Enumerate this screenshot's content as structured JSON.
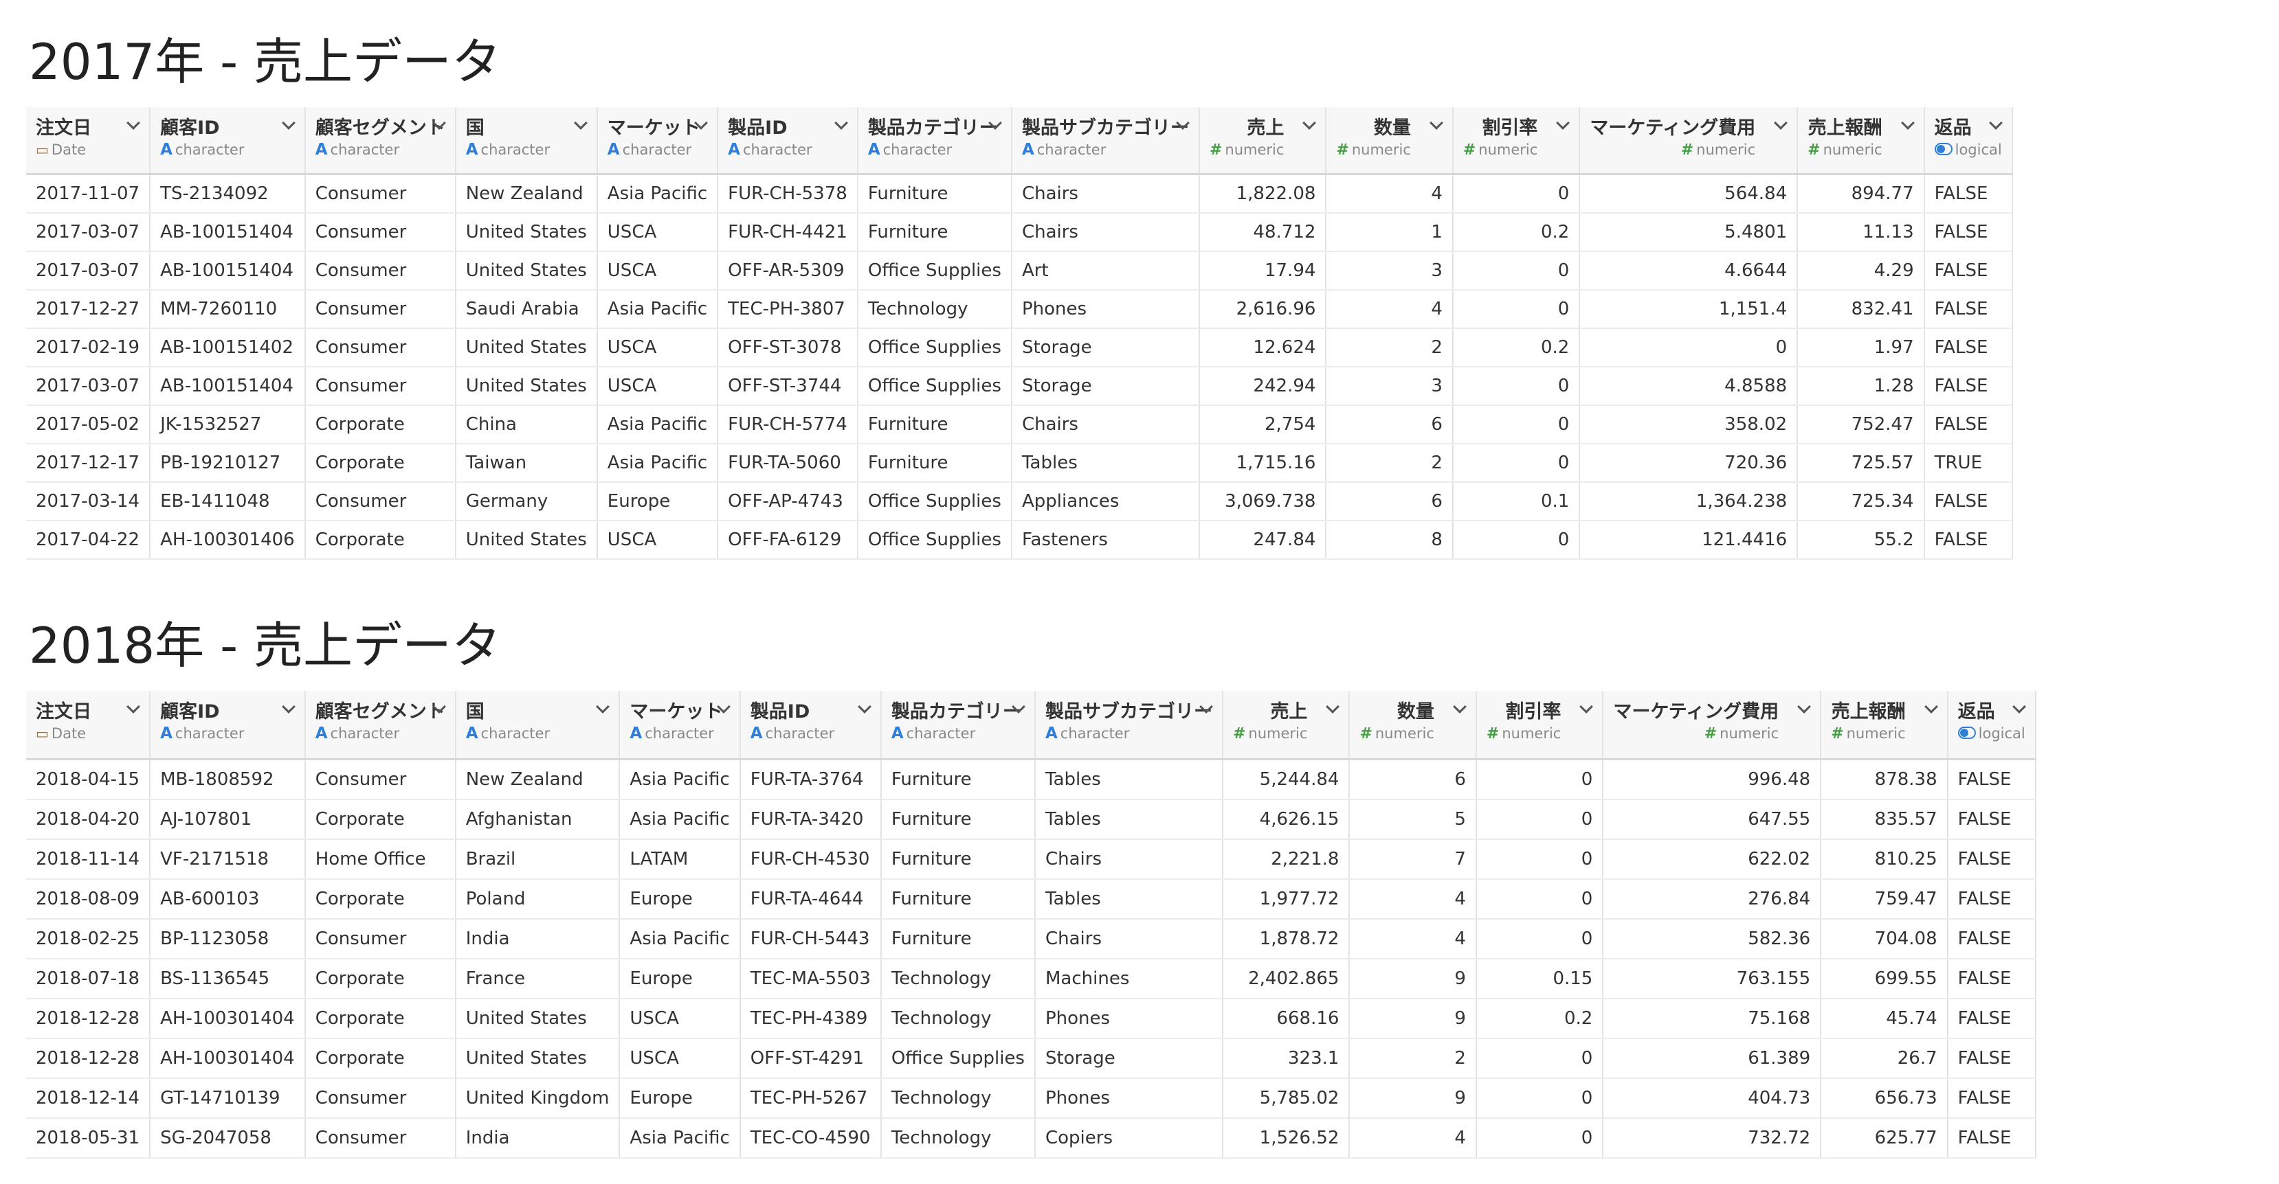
{
  "tables": [
    {
      "title": "2017年 - 売上データ",
      "columns": [
        {
          "name": "注文日",
          "type": "Date",
          "icon": "calendar-icon",
          "align": "left"
        },
        {
          "name": "顧客ID",
          "type": "character",
          "icon": "text-type-icon",
          "align": "left"
        },
        {
          "name": "顧客セグメント",
          "type": "character",
          "icon": "text-type-icon",
          "align": "left"
        },
        {
          "name": "国",
          "type": "character",
          "icon": "text-type-icon",
          "align": "left"
        },
        {
          "name": "マーケット",
          "type": "character",
          "icon": "text-type-icon",
          "align": "left"
        },
        {
          "name": "製品ID",
          "type": "character",
          "icon": "text-type-icon",
          "align": "left"
        },
        {
          "name": "製品カテゴリー",
          "type": "character",
          "icon": "text-type-icon",
          "align": "left"
        },
        {
          "name": "製品サブカテゴリー",
          "type": "character",
          "icon": "text-type-icon",
          "align": "left"
        },
        {
          "name": "売上",
          "type": "numeric",
          "icon": "hash-icon",
          "align": "right"
        },
        {
          "name": "数量",
          "type": "numeric",
          "icon": "hash-icon",
          "align": "right"
        },
        {
          "name": "割引率",
          "type": "numeric",
          "icon": "hash-icon",
          "align": "right"
        },
        {
          "name": "マーケティング費用",
          "type": "numeric",
          "icon": "hash-icon",
          "align": "right"
        },
        {
          "name": "売上報酬",
          "type": "numeric",
          "icon": "hash-icon",
          "align": "right"
        },
        {
          "name": "返品",
          "type": "logical",
          "icon": "toggle-icon",
          "align": "left"
        }
      ],
      "rows": [
        [
          "2017-11-07",
          "TS-2134092",
          "Consumer",
          "New Zealand",
          "Asia Pacific",
          "FUR-CH-5378",
          "Furniture",
          "Chairs",
          "1,822.08",
          "4",
          "0",
          "564.84",
          "894.77",
          "FALSE"
        ],
        [
          "2017-03-07",
          "AB-100151404",
          "Consumer",
          "United States",
          "USCA",
          "FUR-CH-4421",
          "Furniture",
          "Chairs",
          "48.712",
          "1",
          "0.2",
          "5.4801",
          "11.13",
          "FALSE"
        ],
        [
          "2017-03-07",
          "AB-100151404",
          "Consumer",
          "United States",
          "USCA",
          "OFF-AR-5309",
          "Office Supplies",
          "Art",
          "17.94",
          "3",
          "0",
          "4.6644",
          "4.29",
          "FALSE"
        ],
        [
          "2017-12-27",
          "MM-7260110",
          "Consumer",
          "Saudi Arabia",
          "Asia Pacific",
          "TEC-PH-3807",
          "Technology",
          "Phones",
          "2,616.96",
          "4",
          "0",
          "1,151.4",
          "832.41",
          "FALSE"
        ],
        [
          "2017-02-19",
          "AB-100151402",
          "Consumer",
          "United States",
          "USCA",
          "OFF-ST-3078",
          "Office Supplies",
          "Storage",
          "12.624",
          "2",
          "0.2",
          "0",
          "1.97",
          "FALSE"
        ],
        [
          "2017-03-07",
          "AB-100151404",
          "Consumer",
          "United States",
          "USCA",
          "OFF-ST-3744",
          "Office Supplies",
          "Storage",
          "242.94",
          "3",
          "0",
          "4.8588",
          "1.28",
          "FALSE"
        ],
        [
          "2017-05-02",
          "JK-1532527",
          "Corporate",
          "China",
          "Asia Pacific",
          "FUR-CH-5774",
          "Furniture",
          "Chairs",
          "2,754",
          "6",
          "0",
          "358.02",
          "752.47",
          "FALSE"
        ],
        [
          "2017-12-17",
          "PB-19210127",
          "Corporate",
          "Taiwan",
          "Asia Pacific",
          "FUR-TA-5060",
          "Furniture",
          "Tables",
          "1,715.16",
          "2",
          "0",
          "720.36",
          "725.57",
          "TRUE"
        ],
        [
          "2017-03-14",
          "EB-1411048",
          "Consumer",
          "Germany",
          "Europe",
          "OFF-AP-4743",
          "Office Supplies",
          "Appliances",
          "3,069.738",
          "6",
          "0.1",
          "1,364.238",
          "725.34",
          "FALSE"
        ],
        [
          "2017-04-22",
          "AH-100301406",
          "Corporate",
          "United States",
          "USCA",
          "OFF-FA-6129",
          "Office Supplies",
          "Fasteners",
          "247.84",
          "8",
          "0",
          "121.4416",
          "55.2",
          "FALSE"
        ]
      ]
    },
    {
      "title": "2018年 - 売上データ",
      "columns": [
        {
          "name": "注文日",
          "type": "Date",
          "icon": "calendar-icon",
          "align": "left"
        },
        {
          "name": "顧客ID",
          "type": "character",
          "icon": "text-type-icon",
          "align": "left"
        },
        {
          "name": "顧客セグメント",
          "type": "character",
          "icon": "text-type-icon",
          "align": "left"
        },
        {
          "name": "国",
          "type": "character",
          "icon": "text-type-icon",
          "align": "left"
        },
        {
          "name": "マーケット",
          "type": "character",
          "icon": "text-type-icon",
          "align": "left"
        },
        {
          "name": "製品ID",
          "type": "character",
          "icon": "text-type-icon",
          "align": "left"
        },
        {
          "name": "製品カテゴリー",
          "type": "character",
          "icon": "text-type-icon",
          "align": "left"
        },
        {
          "name": "製品サブカテゴリー",
          "type": "character",
          "icon": "text-type-icon",
          "align": "left"
        },
        {
          "name": "売上",
          "type": "numeric",
          "icon": "hash-icon",
          "align": "right"
        },
        {
          "name": "数量",
          "type": "numeric",
          "icon": "hash-icon",
          "align": "right"
        },
        {
          "name": "割引率",
          "type": "numeric",
          "icon": "hash-icon",
          "align": "right"
        },
        {
          "name": "マーケティング費用",
          "type": "numeric",
          "icon": "hash-icon",
          "align": "right"
        },
        {
          "name": "売上報酬",
          "type": "numeric",
          "icon": "hash-icon",
          "align": "right"
        },
        {
          "name": "返品",
          "type": "logical",
          "icon": "toggle-icon",
          "align": "left"
        }
      ],
      "rows": [
        [
          "2018-04-15",
          "MB-1808592",
          "Consumer",
          "New Zealand",
          "Asia Pacific",
          "FUR-TA-3764",
          "Furniture",
          "Tables",
          "5,244.84",
          "6",
          "0",
          "996.48",
          "878.38",
          "FALSE"
        ],
        [
          "2018-04-20",
          "AJ-107801",
          "Corporate",
          "Afghanistan",
          "Asia Pacific",
          "FUR-TA-3420",
          "Furniture",
          "Tables",
          "4,626.15",
          "5",
          "0",
          "647.55",
          "835.57",
          "FALSE"
        ],
        [
          "2018-11-14",
          "VF-2171518",
          "Home Office",
          "Brazil",
          "LATAM",
          "FUR-CH-4530",
          "Furniture",
          "Chairs",
          "2,221.8",
          "7",
          "0",
          "622.02",
          "810.25",
          "FALSE"
        ],
        [
          "2018-08-09",
          "AB-600103",
          "Corporate",
          "Poland",
          "Europe",
          "FUR-TA-4644",
          "Furniture",
          "Tables",
          "1,977.72",
          "4",
          "0",
          "276.84",
          "759.47",
          "FALSE"
        ],
        [
          "2018-02-25",
          "BP-1123058",
          "Consumer",
          "India",
          "Asia Pacific",
          "FUR-CH-5443",
          "Furniture",
          "Chairs",
          "1,878.72",
          "4",
          "0",
          "582.36",
          "704.08",
          "FALSE"
        ],
        [
          "2018-07-18",
          "BS-1136545",
          "Corporate",
          "France",
          "Europe",
          "TEC-MA-5503",
          "Technology",
          "Machines",
          "2,402.865",
          "9",
          "0.15",
          "763.155",
          "699.55",
          "FALSE"
        ],
        [
          "2018-12-28",
          "AH-100301404",
          "Corporate",
          "United States",
          "USCA",
          "TEC-PH-4389",
          "Technology",
          "Phones",
          "668.16",
          "9",
          "0.2",
          "75.168",
          "45.74",
          "FALSE"
        ],
        [
          "2018-12-28",
          "AH-100301404",
          "Corporate",
          "United States",
          "USCA",
          "OFF-ST-4291",
          "Office Supplies",
          "Storage",
          "323.1",
          "2",
          "0",
          "61.389",
          "26.7",
          "FALSE"
        ],
        [
          "2018-12-14",
          "GT-14710139",
          "Consumer",
          "United Kingdom",
          "Europe",
          "TEC-PH-5267",
          "Technology",
          "Phones",
          "5,785.02",
          "9",
          "0",
          "404.73",
          "656.73",
          "FALSE"
        ],
        [
          "2018-05-31",
          "SG-2047058",
          "Consumer",
          "India",
          "Asia Pacific",
          "TEC-CO-4590",
          "Technology",
          "Copiers",
          "1,526.52",
          "4",
          "0",
          "732.72",
          "625.77",
          "FALSE"
        ]
      ]
    }
  ]
}
